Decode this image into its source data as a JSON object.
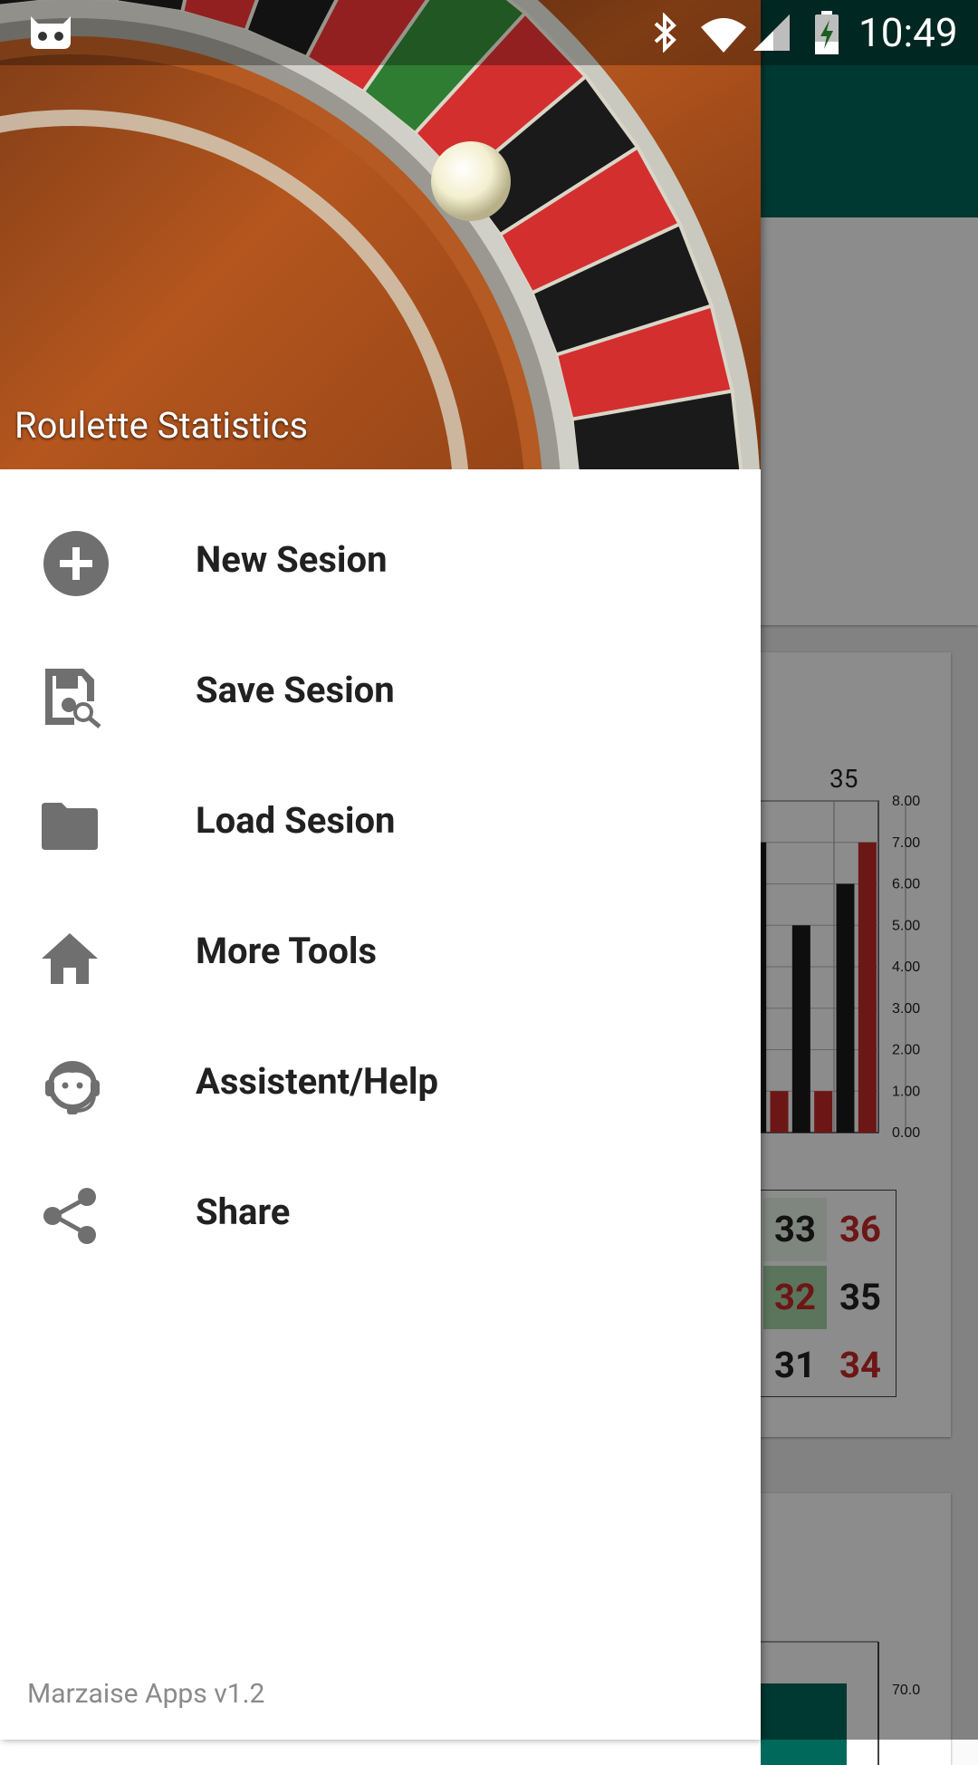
{
  "status_bar": {
    "time": "10:49",
    "icons": [
      "cyanogen-icon",
      "bluetooth-icon",
      "wifi-icon",
      "cell-signal-icon",
      "battery-icon"
    ]
  },
  "drawer": {
    "header_title": "Roulette Statistics",
    "items": [
      {
        "label": "New Sesion",
        "icon": "add-circle-icon"
      },
      {
        "label": "Save Sesion",
        "icon": "save-icon"
      },
      {
        "label": "Load Sesion",
        "icon": "folder-icon"
      },
      {
        "label": "More Tools",
        "icon": "home-icon"
      },
      {
        "label": "Assistent/Help",
        "icon": "support-agent-icon"
      },
      {
        "label": "Share",
        "icon": "share-icon"
      }
    ],
    "footer": "Marzaise Apps v1.2"
  },
  "background": {
    "nav_arrow": "→",
    "number_label": "35",
    "chart_ticks": [
      "8.00",
      "7.00",
      "6.00",
      "5.00",
      "4.00",
      "3.00",
      "2.00",
      "1.00",
      "0.00"
    ],
    "bottom_tick": "70.0",
    "number_grid": [
      [
        {
          "n": "33",
          "color": "black"
        },
        {
          "n": "36",
          "color": "red"
        }
      ],
      [
        {
          "n": "32",
          "color": "red"
        },
        {
          "n": "35",
          "color": "black"
        }
      ],
      [
        {
          "n": "31",
          "color": "black"
        },
        {
          "n": "34",
          "color": "red"
        }
      ]
    ]
  },
  "chart_data": {
    "type": "bar",
    "categories": [
      "",
      "",
      "",
      "",
      "",
      ""
    ],
    "values": [
      7,
      1,
      5,
      1,
      6,
      7
    ],
    "bar_colors": [
      "#1a1a1a",
      "#c62828",
      "#1a1a1a",
      "#c62828",
      "#1a1a1a",
      "#c62828"
    ],
    "ylim": [
      0,
      8
    ]
  },
  "colors": {
    "toolbar": "#00695c",
    "icon_gray": "#6f6f6f",
    "roulette_red": "#c62828",
    "roulette_green": "#2e7d32"
  }
}
